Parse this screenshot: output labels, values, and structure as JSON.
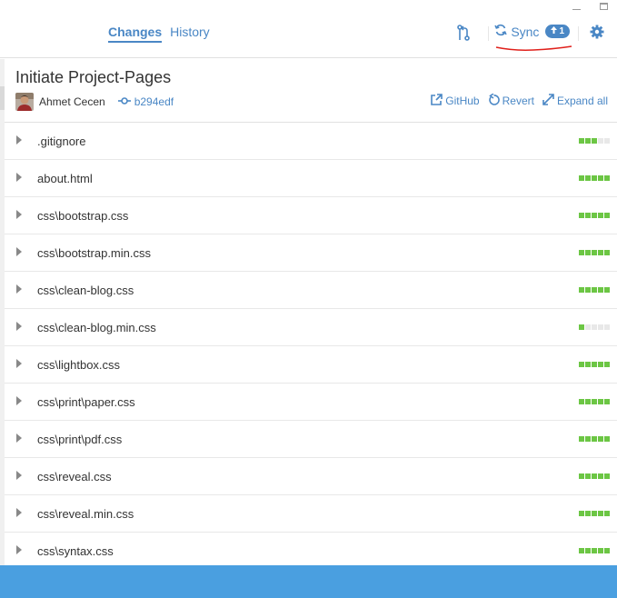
{
  "window": {
    "minimize_icon": "minimize-icon",
    "maximize_icon": "maximize-icon"
  },
  "header": {
    "tabs": [
      {
        "label": "Changes",
        "active": true
      },
      {
        "label": "History",
        "active": false
      }
    ],
    "branch_icon": "branch-icon",
    "sync": {
      "label": "Sync",
      "badge": "1",
      "icon": "sync-icon",
      "badge_icon": "arrow-up-icon"
    },
    "settings_icon": "gear-icon",
    "annotation_color": "#e0201b"
  },
  "commit": {
    "title": "Initiate Project-Pages",
    "author": "Ahmet Cecen",
    "sha": "b294edf",
    "actions": [
      {
        "label": "GitHub",
        "icon": "external-link-icon"
      },
      {
        "label": "Revert",
        "icon": "revert-icon"
      },
      {
        "label": "Expand all",
        "icon": "expand-icon"
      }
    ]
  },
  "files": [
    {
      "name": ".gitignore",
      "stat": 3
    },
    {
      "name": "about.html",
      "stat": 5
    },
    {
      "name": "css\\bootstrap.css",
      "stat": 5
    },
    {
      "name": "css\\bootstrap.min.css",
      "stat": 5
    },
    {
      "name": "css\\clean-blog.css",
      "stat": 5
    },
    {
      "name": "css\\clean-blog.min.css",
      "stat": 1
    },
    {
      "name": "css\\lightbox.css",
      "stat": 5
    },
    {
      "name": "css\\print\\paper.css",
      "stat": 5
    },
    {
      "name": "css\\print\\pdf.css",
      "stat": 5
    },
    {
      "name": "css\\reveal.css",
      "stat": 5
    },
    {
      "name": "css\\reveal.min.css",
      "stat": 5
    },
    {
      "name": "css\\syntax.css",
      "stat": 5
    }
  ],
  "colors": {
    "accent": "#4a87c5",
    "added": "#6cc644",
    "statusbar": "#4a9fe0"
  }
}
